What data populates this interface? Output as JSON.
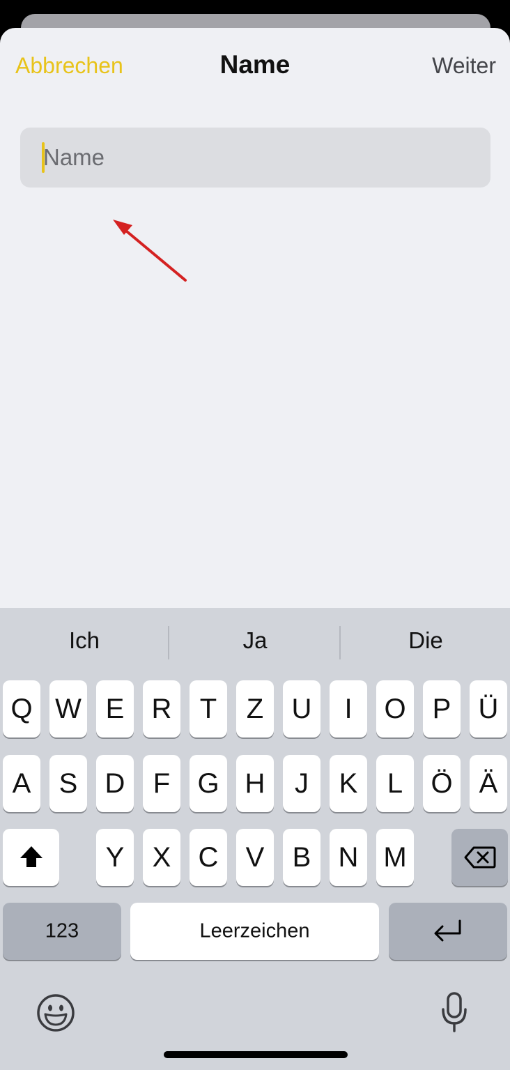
{
  "nav": {
    "cancel_label": "Abbrechen",
    "title": "Name",
    "next_label": "Weiter"
  },
  "name_field": {
    "placeholder": "Name",
    "value": ""
  },
  "keyboard": {
    "suggestions": [
      "Ich",
      "Ja",
      "Die"
    ],
    "row1": [
      "Q",
      "W",
      "E",
      "R",
      "T",
      "Z",
      "U",
      "I",
      "O",
      "P",
      "Ü"
    ],
    "row2": [
      "A",
      "S",
      "D",
      "F",
      "G",
      "H",
      "J",
      "K",
      "L",
      "Ö",
      "Ä"
    ],
    "row3": [
      "Y",
      "X",
      "C",
      "V",
      "B",
      "N",
      "M"
    ],
    "numbers_label": "123",
    "space_label": "Leerzeichen"
  },
  "colors": {
    "accent": "#e8c31a",
    "annotation_arrow": "#d42121"
  },
  "icons": {
    "shift": "shift-icon",
    "delete": "delete-backspace-icon",
    "return": "return-icon",
    "emoji": "emoji-icon",
    "dictation": "microphone-icon"
  }
}
